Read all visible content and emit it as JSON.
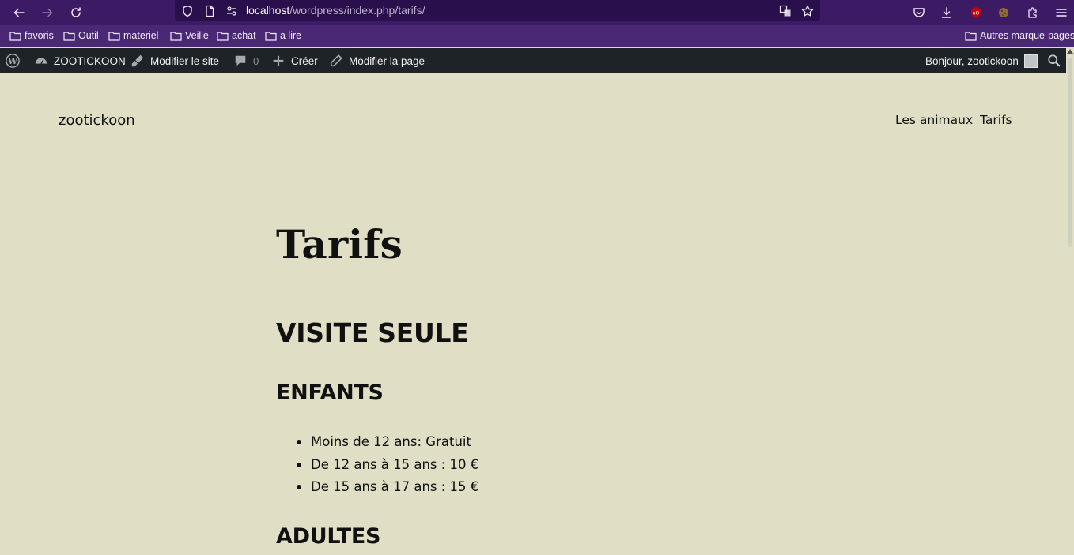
{
  "browser": {
    "url_host": "localhost",
    "url_path": "/wordpress/index.php/tarifs/"
  },
  "bookmarks": {
    "items": [
      "favoris",
      "Outil",
      "materiel",
      "Veille",
      "achat",
      "a lire"
    ],
    "other": "Autres marque-pages"
  },
  "adminbar": {
    "site_name": "ZOOTICKOON",
    "edit_site": "Modifier le site",
    "comments_count": "0",
    "create": "Créer",
    "edit_page": "Modifier la page",
    "greeting": "Bonjour, zootickoon"
  },
  "site": {
    "title": "zootickoon",
    "nav": [
      "Les animaux",
      "Tarifs"
    ]
  },
  "content": {
    "page_title": "Tarifs",
    "section_title": "VISITE SEULE",
    "children_title": "ENFANTS",
    "children_prices": [
      "Moins de 12 ans: Gratuit",
      "De 12 ans à 15 ans : 10 €",
      "De 15 ans à 17 ans : 15 €"
    ],
    "adults_title": "ADULTES"
  },
  "colors": {
    "toolbar": "#3d1a64",
    "bookmarks_bar": "#4a2875",
    "adminbar": "#1d2327",
    "page_background": "#e0dfc6"
  }
}
